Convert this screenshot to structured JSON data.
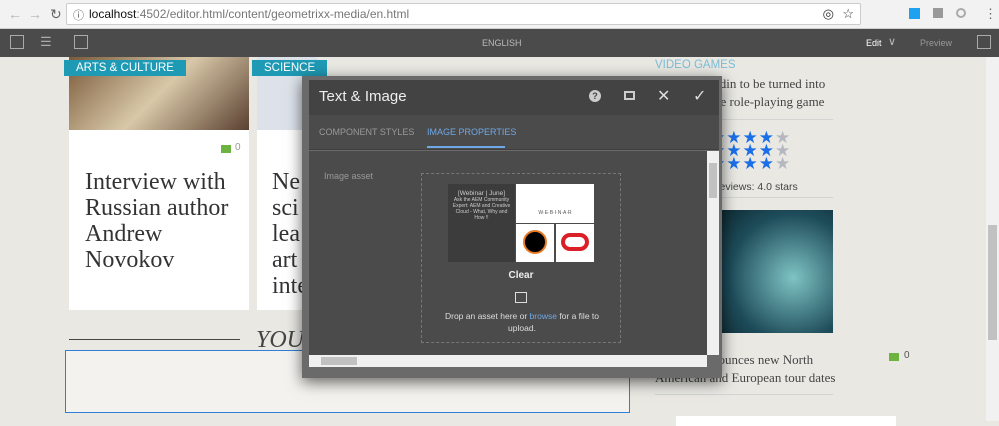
{
  "browser": {
    "url_host": "localhost",
    "url_rest": ":4502/editor.html/content/geometrixx-media/en.html"
  },
  "toolbar": {
    "title": "ENGLISH",
    "edit_label": "Edit",
    "preview_label": "Preview"
  },
  "cards": [
    {
      "tag": "ARTS & CULTURE",
      "comments": "0",
      "title": "Interview with Russian author Andrew Novokov"
    },
    {
      "tag": "SCIENCE",
      "title_lines": [
        "Ne",
        "sci",
        "lea",
        "art",
        "inte"
      ]
    }
  ],
  "section_heading": "YOU",
  "dialog": {
    "title": "Text & Image",
    "tabs": [
      {
        "label": "COMPONENT STYLES",
        "active": false
      },
      {
        "label": "IMAGE PROPERTIES",
        "active": true
      }
    ],
    "field_label": "Image asset",
    "thumb": {
      "line1": "[Webinar | June]",
      "line2": "Ask the AEM Community Expert: AEM and Creative Cloud - What, Why and How !!",
      "webinar": "W·E·B·I·N·A·R"
    },
    "clear_label": "Clear",
    "drop_prefix": "Drop an asset here or ",
    "browse_link": "browse",
    "drop_suffix": " for a file to upload."
  },
  "sidebar": {
    "category": "VIDEO GAMES",
    "line1": "adin to be turned into",
    "line2": "ne role-playing game",
    "rating_rows": 3,
    "rating": 4,
    "max_rating": 5,
    "reviews_text": "reviews: 4.0 stars",
    "article_line1": "nounces new North",
    "article_line2": "American and European tour dates",
    "comments": "0"
  },
  "colors": {
    "accent": "#1f9ab4",
    "active_tab": "#6fa8e6",
    "star": "#1a6fe8",
    "comment": "#6db33f"
  }
}
